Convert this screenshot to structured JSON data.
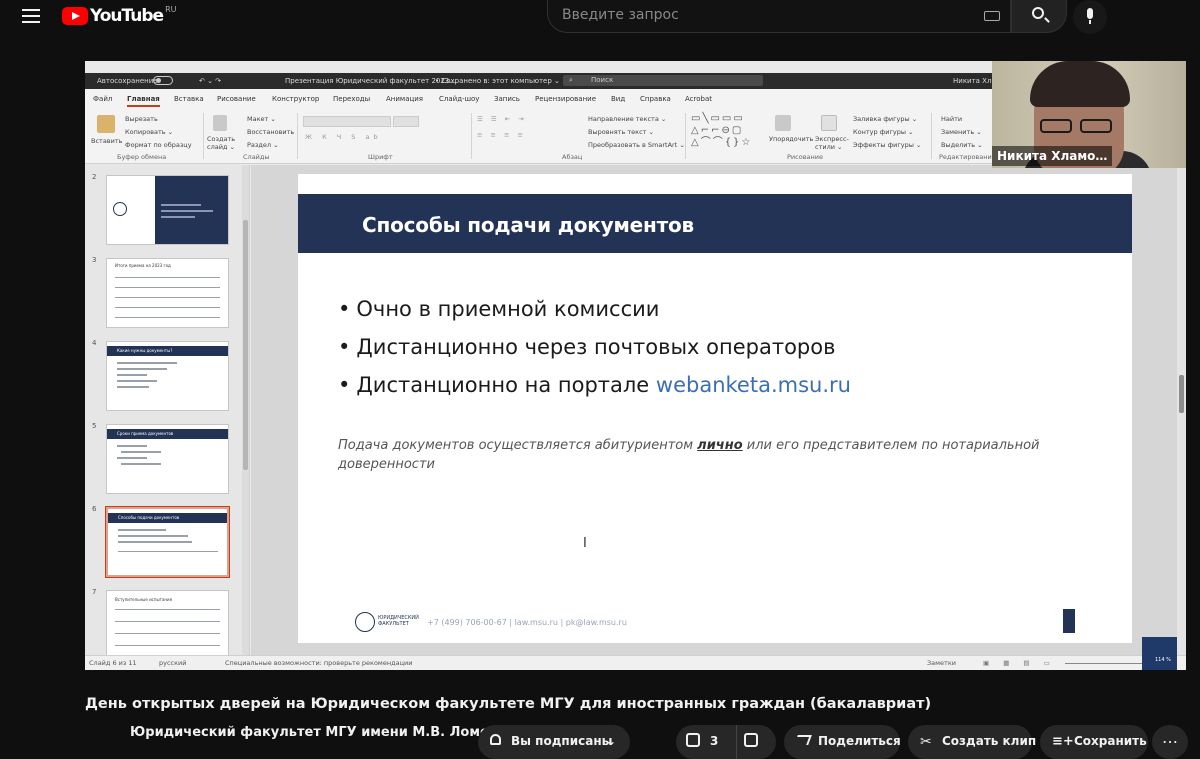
{
  "youtube": {
    "logo_text": "YouTube",
    "region": "RU",
    "search_placeholder": "Введите запрос"
  },
  "powerpoint": {
    "autosave_label": "Автосохранение",
    "doc_title": "Презентация Юридический факультет 2023…",
    "saved_status": "• Сохранено в: этот компьютер ⌄",
    "search_label": "Поиск",
    "user_name": "Никита Хлам…",
    "tabs": [
      "Файл",
      "Главная",
      "Вставка",
      "Рисование",
      "Конструктор",
      "Переходы",
      "Анимация",
      "Слайд-шоу",
      "Запись",
      "Рецензирование",
      "Вид",
      "Справка",
      "Acrobat"
    ],
    "ribbon": {
      "paste": "Вставить",
      "cut": "Вырезать",
      "copy": "Копировать ⌄",
      "format_painter": "Формат по образцу",
      "clipboard_group": "Буфер обмена",
      "new_slide": "Создать слайд ⌄",
      "layout": "Макет ⌄",
      "reset": "Восстановить",
      "section": "Раздел ⌄",
      "slides_group": "Слайды",
      "font_group": "Шрифт",
      "text_direction": "Направление текста ⌄",
      "align_text": "Выровнять текст ⌄",
      "smartart": "Преобразовать в SmartArt ⌄",
      "paragraph_group": "Абзац",
      "arrange": "Упорядочить",
      "quick_styles": "Экспресс-стили ⌄",
      "shape_fill": "Заливка фигуры ⌄",
      "shape_outline": "Контур фигуры ⌄",
      "shape_effects": "Эффекты фигуры ⌄",
      "drawing_group": "Рисование",
      "find": "Найти",
      "replace": "Заменить ⌄",
      "select": "Выделить ⌄",
      "editing_group": "Редактирование"
    },
    "thumbnails": [
      {
        "num": "2",
        "title": ""
      },
      {
        "num": "3",
        "title": "Итоги приема на 2023 год"
      },
      {
        "num": "4",
        "title": "Какие нужны документы?"
      },
      {
        "num": "5",
        "title": "Сроки приема документов"
      },
      {
        "num": "6",
        "title": "Способы подачи документов"
      },
      {
        "num": "7",
        "title": "Вступительные испытания"
      }
    ],
    "slide": {
      "title": "Способы подачи документов",
      "bullet1": "Очно в приемной комиссии",
      "bullet2": "Дистанционно через почтовых операторов",
      "bullet3_prefix": "Дистанционно на портале ",
      "bullet3_link": "webanketa.msu.ru",
      "note_part1": "Подача документов осуществляется абитуриентом ",
      "note_emph": "лично",
      "note_part2": " или его представителем по нотариальной доверенности",
      "footer_org": "ЮРИДИЧЕСКИЙ ФАКУЛЬТЕТ",
      "footer_contact": "+7 (499) 706-00-67 | law.msu.ru | pk@law.msu.ru",
      "page_number": "6"
    },
    "status": {
      "slide_of": "Слайд 6 из 11",
      "language": "русский",
      "accessibility": "Специальные возможности: проверьте рекомендации",
      "notes": "Заметки",
      "zoom_percent": "114 %"
    }
  },
  "zoom_watermark": "zoom",
  "participant_name": "Никита Хламо…",
  "video": {
    "title": "День открытых дверей на Юридическом факультете МГУ для иностранных граждан (бакалавриат)",
    "channel": "Юридический факультет МГУ имени М.В. Ломон…",
    "subscribed_label": "Вы подписаны",
    "likes": "3",
    "share_label": "Поделиться",
    "clip_label": "Создать клип",
    "save_label": "Сохранить",
    "more_label": "…"
  }
}
